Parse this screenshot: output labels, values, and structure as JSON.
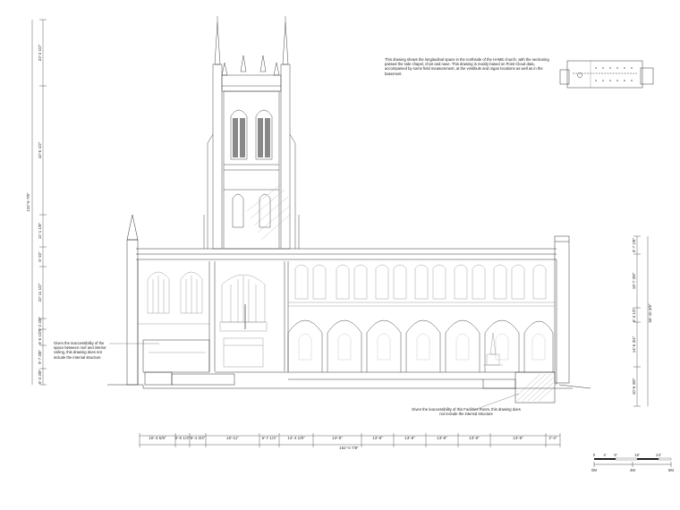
{
  "notes": {
    "top": "This drawing shows the longitudinal space in the northside of the HAME church, with the sectioning passed the side chapel, choir and nave. This drawing is mainly based on Point Cloud data, accompanied by some field measurement, at the vestibule and organ locations as well as in the basement.",
    "left": "Given the inaccessibility of the space between roof and interior ceiling, this drawing does not include the internal structure",
    "right": "Given the inaccessibility of this Facilities Room, this drawing does not include the internal structure"
  },
  "bottom_dimensions": {
    "segments": [
      "15'-3 5/8\"",
      "6'-6 1/4\"",
      "6'-4 3/4\"",
      "16'-11\"",
      "5'-7 1/4\"",
      "14'-4 1/8\"",
      "13'-8\"",
      "13'-8\"",
      "13'-8\"",
      "13'-8\"",
      "13'-8\"",
      "13'-8\"",
      "2'-3\""
    ],
    "total": "152'-0 7/8\""
  },
  "left_dimensions": {
    "segments": [
      "23'-3 1/2\"",
      "42'-6 1/2\"",
      "11'-1 1/8\"",
      "5'-10\"",
      "22'-11 1/2\"",
      "6'-2 3/8\"",
      "6'-6 1/2\"",
      "9'-7 3/8\"",
      "5'-3 3/8\""
    ],
    "total": "132'-5 7/8\""
  },
  "right_dimensions": {
    "segments": [
      "6'-7 1/8\"",
      "18'-7 3/8\"",
      "6'-3 1/2\"",
      "14'-6 3/4\"",
      "10'-6 3/8\""
    ],
    "total": "56'-10 3/8\""
  },
  "scale_bar": {
    "imperial_labels": [
      "0",
      "4'",
      "8'",
      "16'",
      "24'"
    ],
    "metric_labels": [
      "0M",
      "4M",
      "8M"
    ]
  }
}
